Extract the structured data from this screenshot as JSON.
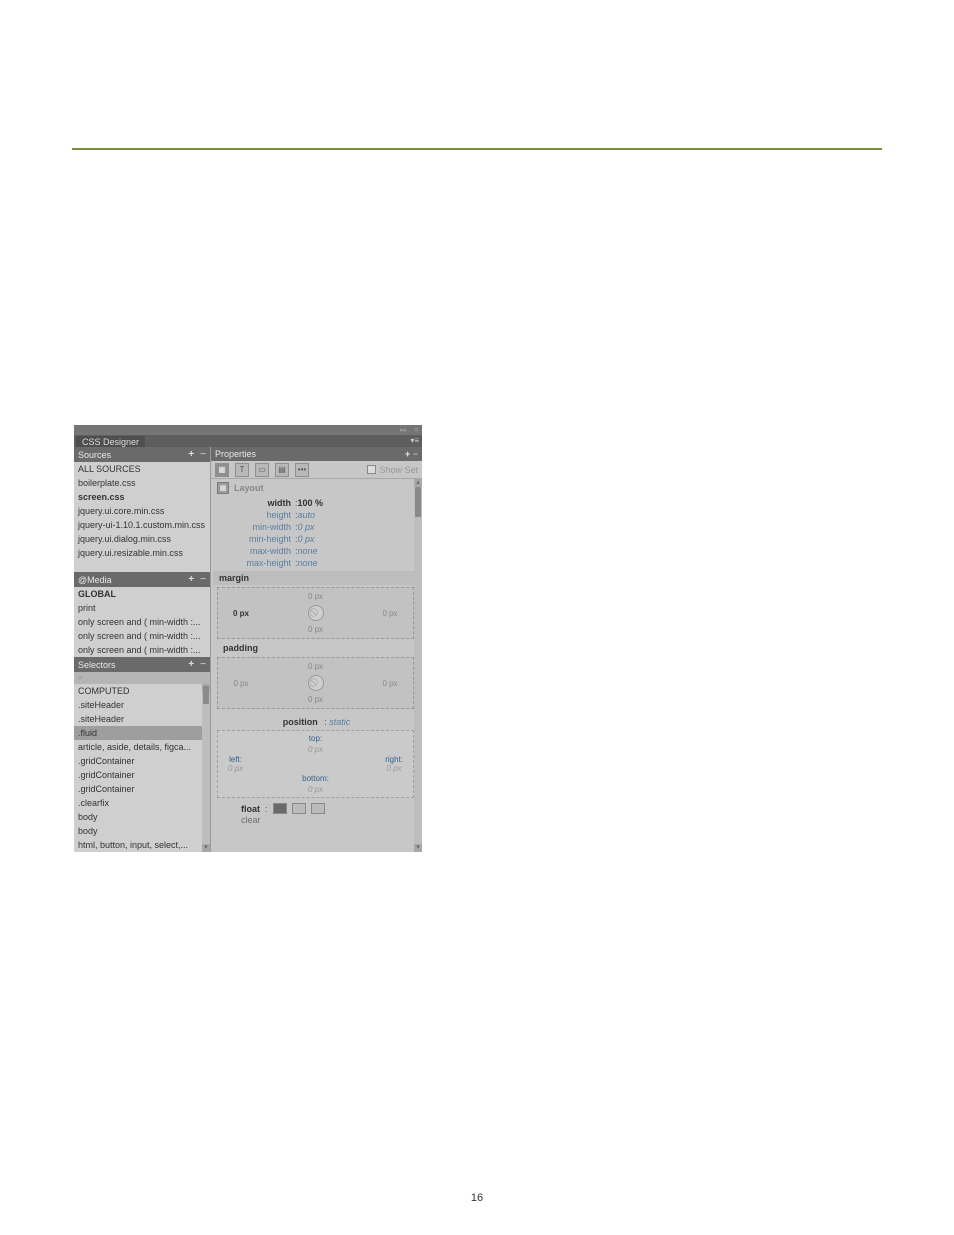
{
  "page": {
    "number": "16"
  },
  "panel": {
    "tab": "CSS Designer",
    "sources": {
      "header": "Sources",
      "items": [
        {
          "label": "ALL SOURCES",
          "bold": false
        },
        {
          "label": "boilerplate.css",
          "bold": false
        },
        {
          "label": "screen.css",
          "bold": true
        },
        {
          "label": "jquery.ui.core.min.css",
          "bold": false
        },
        {
          "label": "jquery-ui-1.10.1.custom.min.css",
          "bold": false
        },
        {
          "label": "jquery.ui.dialog.min.css",
          "bold": false
        },
        {
          "label": "jquery.ui.resizable.min.css",
          "bold": false
        }
      ]
    },
    "media": {
      "header": "@Media",
      "items": [
        {
          "label": "GLOBAL",
          "bold": true
        },
        {
          "label": "print",
          "bold": false
        },
        {
          "label": "only screen and ( min-width :...",
          "bold": false
        },
        {
          "label": "only screen and ( min-width :...",
          "bold": false
        },
        {
          "label": "only screen and ( min-width :...",
          "bold": false
        }
      ]
    },
    "selectors": {
      "header": "Selectors",
      "search_placeholder": "",
      "items": [
        {
          "label": "COMPUTED",
          "selected": false
        },
        {
          "label": ".siteHeader",
          "selected": false
        },
        {
          "label": ".siteHeader",
          "selected": false
        },
        {
          "label": ".fluid",
          "selected": true
        },
        {
          "label": "article, aside, details, figca...",
          "selected": false
        },
        {
          "label": ".gridContainer",
          "selected": false
        },
        {
          "label": ".gridContainer",
          "selected": false
        },
        {
          "label": ".gridContainer",
          "selected": false
        },
        {
          "label": ".clearfix",
          "selected": false
        },
        {
          "label": "body",
          "selected": false
        },
        {
          "label": "body",
          "selected": false
        },
        {
          "label": "html, button, input, select,...",
          "selected": false
        }
      ]
    },
    "properties": {
      "header": "Properties",
      "show_set": "Show Set",
      "layout_label": "Layout",
      "width": {
        "k": "width",
        "v": "100 %"
      },
      "height": {
        "k": "height",
        "v": "auto"
      },
      "minw": {
        "k": "min-width",
        "v": "0 px"
      },
      "minh": {
        "k": "min-height",
        "v": "0 px"
      },
      "maxw": {
        "k": "max-width",
        "v": "none"
      },
      "maxh": {
        "k": "max-height",
        "v": "none"
      },
      "margin": {
        "label": "margin",
        "top": "0 px",
        "right": "0 px",
        "bottom": "0 px",
        "left": "0 px"
      },
      "padding": {
        "label": "padding",
        "top": "0 px",
        "right": "0 px",
        "bottom": "0 px",
        "left": "0 px"
      },
      "position": {
        "k": "position",
        "v": "static"
      },
      "offsets": {
        "top": {
          "k": "top:",
          "v": "0 px"
        },
        "right": {
          "k": "right:",
          "v": "0 px"
        },
        "bottom": {
          "k": "bottom:",
          "v": "0 px"
        },
        "left": {
          "k": "left:",
          "v": "0 px"
        }
      },
      "float": {
        "k": "float"
      },
      "clear": {
        "k": "clear"
      }
    }
  }
}
